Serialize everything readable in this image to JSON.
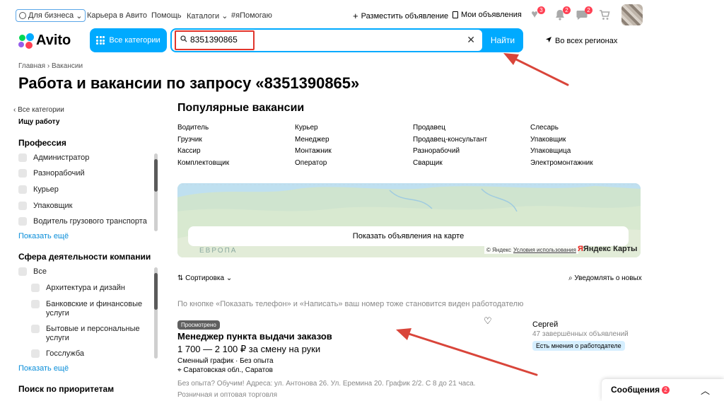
{
  "topnav": {
    "business": "Для бизнеса",
    "links": [
      "Карьера в Авито",
      "Помощь",
      "Каталоги",
      "#яПомогаю"
    ],
    "post_ad": "Разместить объявление",
    "my_ads": "Мои объявления",
    "badges": {
      "favorites": "3",
      "notifications": "2",
      "messages": "2"
    }
  },
  "header": {
    "logo": "Avito",
    "categories_button": "Все категории",
    "search_value": "8351390865",
    "find_button": "Найти",
    "region": "Во всех регионах"
  },
  "breadcrumbs": "Главная › Вакансии",
  "page_title": "Работа и вакансии по запросу «8351390865»",
  "sidebar": {
    "back": "Все категории",
    "subtitle": "Ищу работу",
    "profession_title": "Профессия",
    "professions": [
      "Администратор",
      "Разнорабочий",
      "Курьер",
      "Упаковщик",
      "Водитель грузового транспорта"
    ],
    "show_more": "Показать ещё",
    "sphere_title": "Сфера деятельности компании",
    "sphere_all": "Все",
    "spheres": [
      "Архитектура и дизайн",
      "Банковские и финансовые услуги",
      "Бытовые и персональные услуги",
      "Госслужба"
    ],
    "show_more_2": "Показать ещё",
    "priority_title": "Поиск по приоритетам"
  },
  "popular": {
    "title": "Популярные вакансии",
    "items": [
      "Водитель",
      "Курьер",
      "Продавец",
      "Слесарь",
      "Грузчик",
      "Менеджер",
      "Продавец-консультант",
      "Упаковщик",
      "Кассир",
      "Монтажник",
      "Разнорабочий",
      "Упаковщица",
      "Комплектовщик",
      "Оператор",
      "Сварщик",
      "Электромонтажник"
    ]
  },
  "map": {
    "show_button": "Показать объявления на карте",
    "region_label": "ЕВРОПА",
    "copyright": "© Яндекс",
    "terms": "Условия использования",
    "brand": "Яндекс Карты"
  },
  "results": {
    "sort": "Сортировка",
    "notify": "Уведомлять о новых",
    "phone_note": "По кнопке «Показать телефон» и «Написать» ваш номер тоже становится виден работодателю"
  },
  "vacancy": {
    "seen_badge": "Просмотрено",
    "title": "Менеджер пункта выдачи заказов",
    "price": "1 700 — 2 100 ₽ за смену на руки",
    "schedule": "Сменный график · Без опыта",
    "location": "Саратовская обл., Саратов",
    "description": "Без опыта? Обучим! Адреса: ул. Антонова 26. Ул. Еремина 20. График 2/2. С 8 до 21 часа.",
    "category": "Розничная и оптовая торговля",
    "seller_name": "Сергей",
    "seller_count": "47 завершённых объявлений",
    "seller_tag": "Есть мнения о работодателе"
  },
  "messages": {
    "label": "Сообщения",
    "count": "2"
  },
  "colors": {
    "accent": "#00aaff",
    "badge": "#ff4053",
    "annotation": "#d9453a",
    "link": "#0a8ed9"
  }
}
